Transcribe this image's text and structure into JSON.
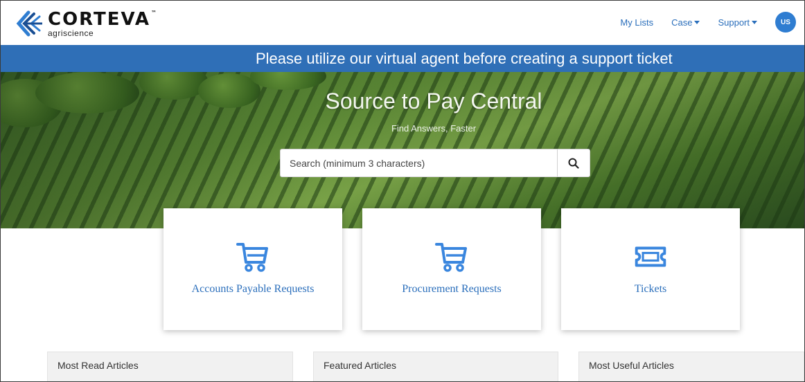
{
  "header": {
    "brand": "CORTEVA",
    "brand_tm": "™",
    "brand_sub": "agriscience",
    "nav": {
      "my_lists": "My Lists",
      "case": "Case",
      "support": "Support"
    },
    "avatar_initials": "US"
  },
  "banner": {
    "text": "Please utilize our virtual agent before creating a support ticket"
  },
  "hero": {
    "title": "Source to Pay Central",
    "subtitle": "Find Answers, Faster",
    "search_placeholder": "Search (minimum 3 characters)"
  },
  "cards": [
    {
      "label": "Accounts Payable Requests",
      "icon": "cart-icon"
    },
    {
      "label": "Procurement Requests",
      "icon": "cart-icon"
    },
    {
      "label": "Tickets",
      "icon": "ticket-icon"
    }
  ],
  "sections": [
    {
      "title": "Most Read Articles"
    },
    {
      "title": "Featured Articles"
    },
    {
      "title": "Most Useful Articles"
    }
  ],
  "colors": {
    "accent": "#2a6ebb",
    "banner": "#2f6fb7",
    "icon": "#3a86de"
  }
}
